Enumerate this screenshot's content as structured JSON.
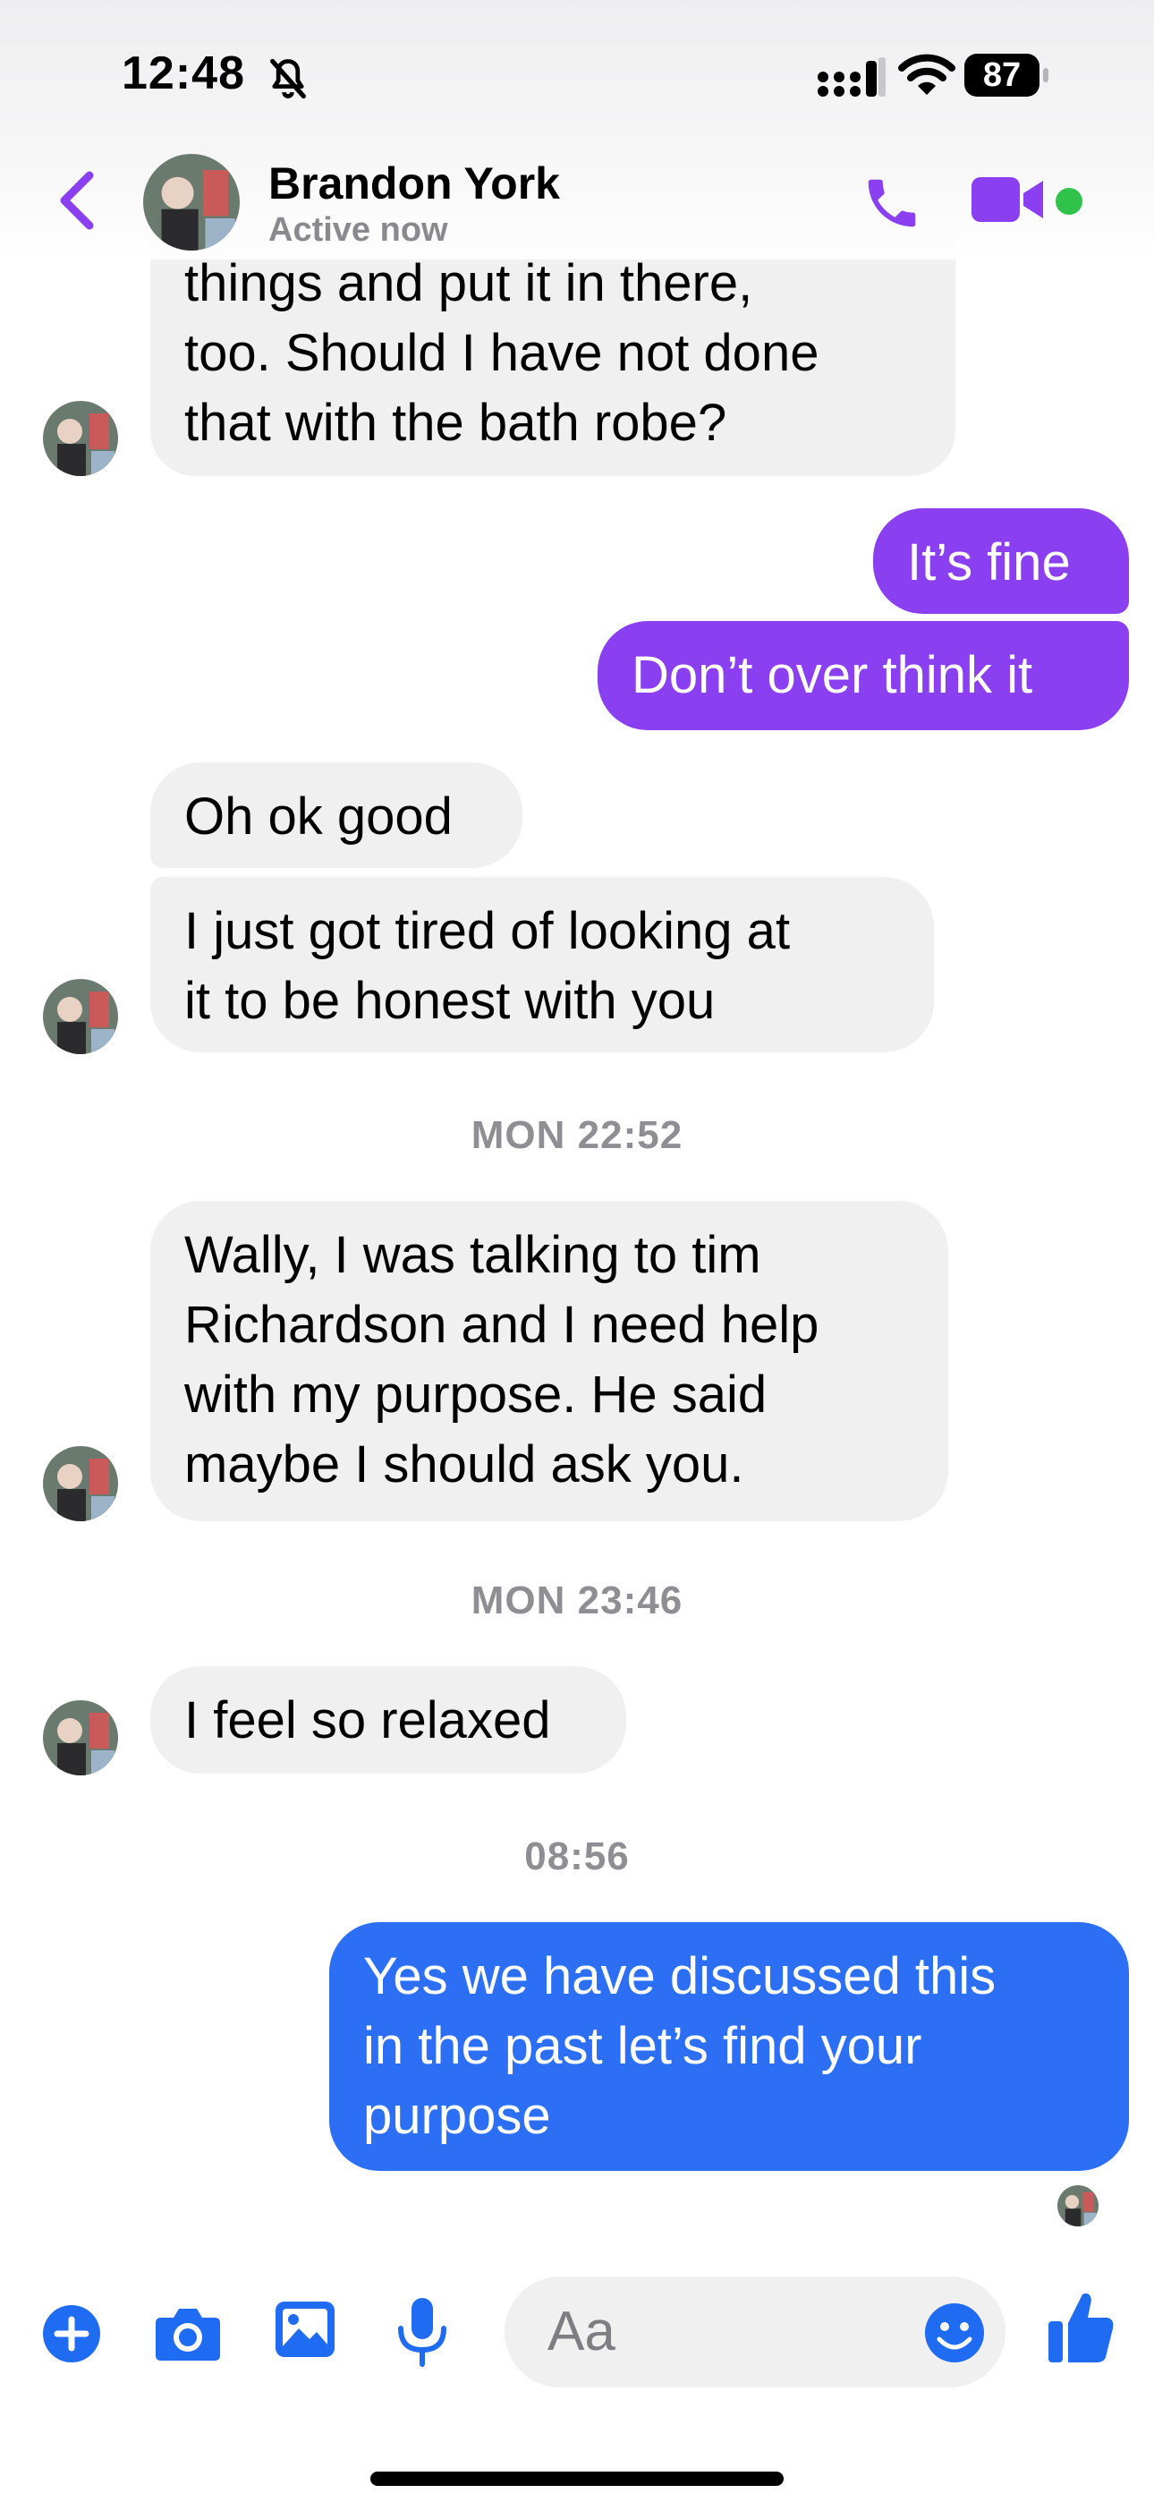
{
  "status_bar": {
    "time": "12:48",
    "battery": "87"
  },
  "header": {
    "contact_name": "Brandon York",
    "status": "Active now"
  },
  "messages": [
    {
      "dir": "in",
      "text": "things and put it in there,\ntoo. Should I have not done\nthat with the bath robe?"
    },
    {
      "dir": "out",
      "text": "It’s fine"
    },
    {
      "dir": "out",
      "text": "Don’t over think it"
    },
    {
      "dir": "in",
      "text": "Oh ok good"
    },
    {
      "dir": "in",
      "text": "I just got tired of looking at\nit to be honest with you"
    },
    {
      "dir": "in",
      "text": "Wally, I was talking to tim\nRichardson and I need help\nwith my purpose. He said\nmaybe I should ask you."
    },
    {
      "dir": "in",
      "text": "I feel so relaxed"
    },
    {
      "dir": "out",
      "text": "Yes we have discussed this\nin the past let’s find your\npurpose"
    }
  ],
  "timestamps": [
    "MON 22:52",
    "MON 23:46",
    "08:56"
  ],
  "composer": {
    "placeholder": "Aa"
  },
  "colors": {
    "accent_purple": "#8a3ff0",
    "accent_blue": "#2c6ff5",
    "incoming_bubble": "#f0f0f0",
    "online": "#31c24b"
  },
  "icons": [
    "back-chevron-icon",
    "phone-icon",
    "video-camera-icon",
    "plus-icon",
    "camera-icon",
    "gallery-icon",
    "microphone-icon",
    "emoji-icon",
    "thumbs-up-icon",
    "bell-slash-icon",
    "signal-icon",
    "wifi-icon"
  ]
}
